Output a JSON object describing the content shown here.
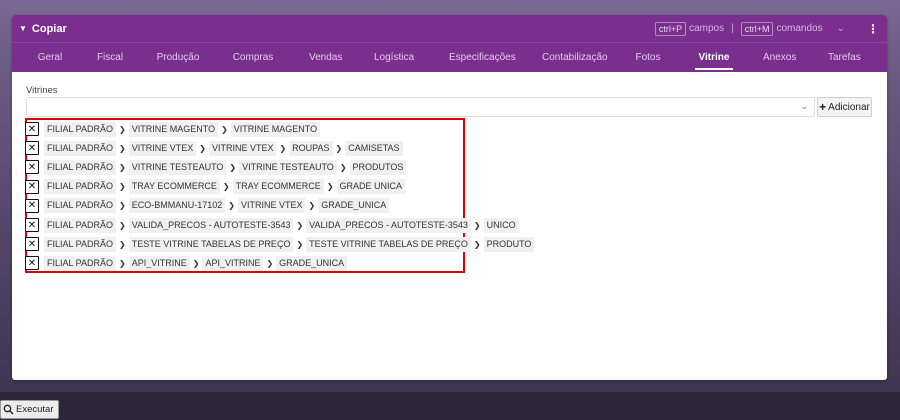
{
  "header": {
    "title": "Copiar",
    "shortcuts": [
      {
        "key": "ctrl+P",
        "label": "campos"
      },
      {
        "key": "ctrl+M",
        "label": "comandos"
      }
    ],
    "separator": "|"
  },
  "tabs": [
    {
      "label": "Geral"
    },
    {
      "label": "Fiscal"
    },
    {
      "label": "Produção"
    },
    {
      "label": "Compras"
    },
    {
      "label": "Vendas"
    },
    {
      "label": "Logística"
    },
    {
      "label": "Especificações"
    },
    {
      "label": "Contabilização"
    },
    {
      "label": "Fotos"
    },
    {
      "label": "Vitrine",
      "active": true
    },
    {
      "label": "Anexos"
    },
    {
      "label": "Tarefas"
    }
  ],
  "vitrines": {
    "label": "Vitrines",
    "select_value": "",
    "add_button": "Adicionar",
    "items": [
      [
        "FILIAL PADRÃO",
        "VITRINE MAGENTO",
        "VITRINE MAGENTO"
      ],
      [
        "FILIAL PADRÃO",
        "VITRINE VTEX",
        "VITRINE VTEX",
        "ROUPAS",
        "CAMISETAS"
      ],
      [
        "FILIAL PADRÃO",
        "VITRINE TESTEAUTO",
        "VITRINE TESTEAUTO",
        "PRODUTOS"
      ],
      [
        "FILIAL PADRÃO",
        "TRAY ECOMMERCE",
        "TRAY ECOMMERCE",
        "GRADE UNICA"
      ],
      [
        "FILIAL PADRÃO",
        "ECO-BMMANU-17102",
        "VITRINE VTEX",
        "GRADE_UNICA"
      ],
      [
        "FILIAL PADRÃO",
        "VALIDA_PRECOS - AUTOTESTE-3543",
        "VALIDA_PRECOS - AUTOTESTE-3543",
        "UNICO"
      ],
      [
        "FILIAL PADRÃO",
        "TESTE VITRINE TABELAS DE PREÇO",
        "TESTE VITRINE TABELAS DE PREÇO",
        "PRODUTO"
      ],
      [
        "FILIAL PADRÃO",
        "API_VITRINE",
        "API_VITRINE",
        "GRADE_UNICA"
      ]
    ]
  },
  "footer": {
    "execute_button": "Executar"
  }
}
